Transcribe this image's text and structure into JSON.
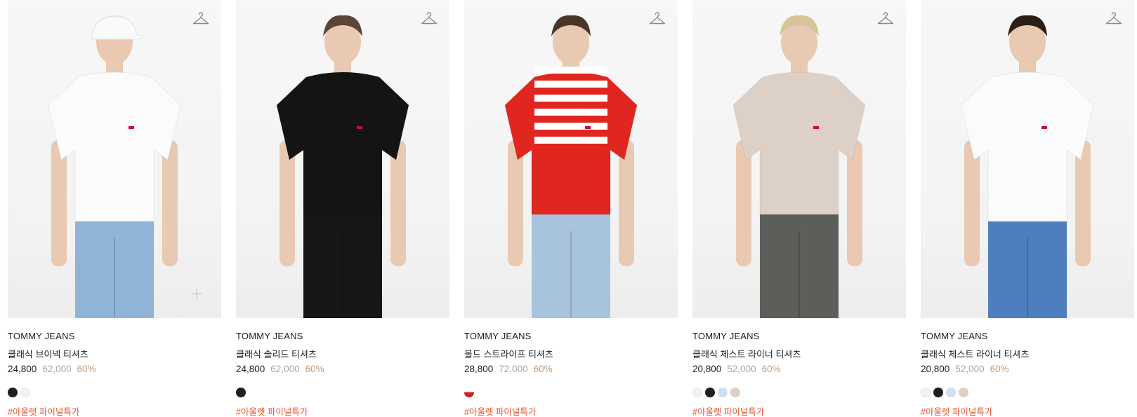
{
  "products": [
    {
      "brand": "TOMMY JEANS",
      "name": "클래식 브이넥 티셔츠",
      "price": "24,800",
      "original_price": "62,000",
      "discount": "60%",
      "swatches": [
        "#1f1f1f",
        "#f2f2f2"
      ],
      "tag": "#아울렛 파이널특가",
      "shirt_color": "#fbfbfb",
      "pants_color": "#8fb4d8",
      "has_plus": true
    },
    {
      "brand": "TOMMY JEANS",
      "name": "클래식 솔리드 티셔츠",
      "price": "24,800",
      "original_price": "62,000",
      "discount": "60%",
      "swatches": [
        "#1f1f1f"
      ],
      "tag": "#아울렛 파이널특가",
      "shirt_color": "#141414",
      "pants_color": "#161616",
      "has_plus": false
    },
    {
      "brand": "TOMMY JEANS",
      "name": "볼드 스트라이프 티셔츠",
      "price": "28,800",
      "original_price": "72,000",
      "discount": "60%",
      "swatches": [
        "#d32020"
      ],
      "tag": "#아울렛 파이널특가",
      "shirt_color": "#e0261f",
      "pants_color": "#a7c3de",
      "has_plus": false
    },
    {
      "brand": "TOMMY JEANS",
      "name": "클래식 체스트 라이너 티셔츠",
      "price": "20,800",
      "original_price": "52,000",
      "discount": "60%",
      "swatches": [
        "#f2f2f2",
        "#1f1f1f",
        "#cfe0f5",
        "#ddd0c3"
      ],
      "tag": "#아울렛 파이널특가",
      "shirt_color": "#ddd0c6",
      "pants_color": "#5c5f59",
      "has_plus": false
    },
    {
      "brand": "TOMMY JEANS",
      "name": "클래식 체스트 라이너 티셔츠",
      "price": "20,800",
      "original_price": "52,000",
      "discount": "60%",
      "swatches": [
        "#f2f2f2",
        "#1f1f1f",
        "#cfe0f5",
        "#ddd0c3"
      ],
      "tag": "#아울렛 파이널특가",
      "shirt_color": "#fbfbfb",
      "pants_color": "#4d7fbe",
      "has_plus": false
    }
  ]
}
